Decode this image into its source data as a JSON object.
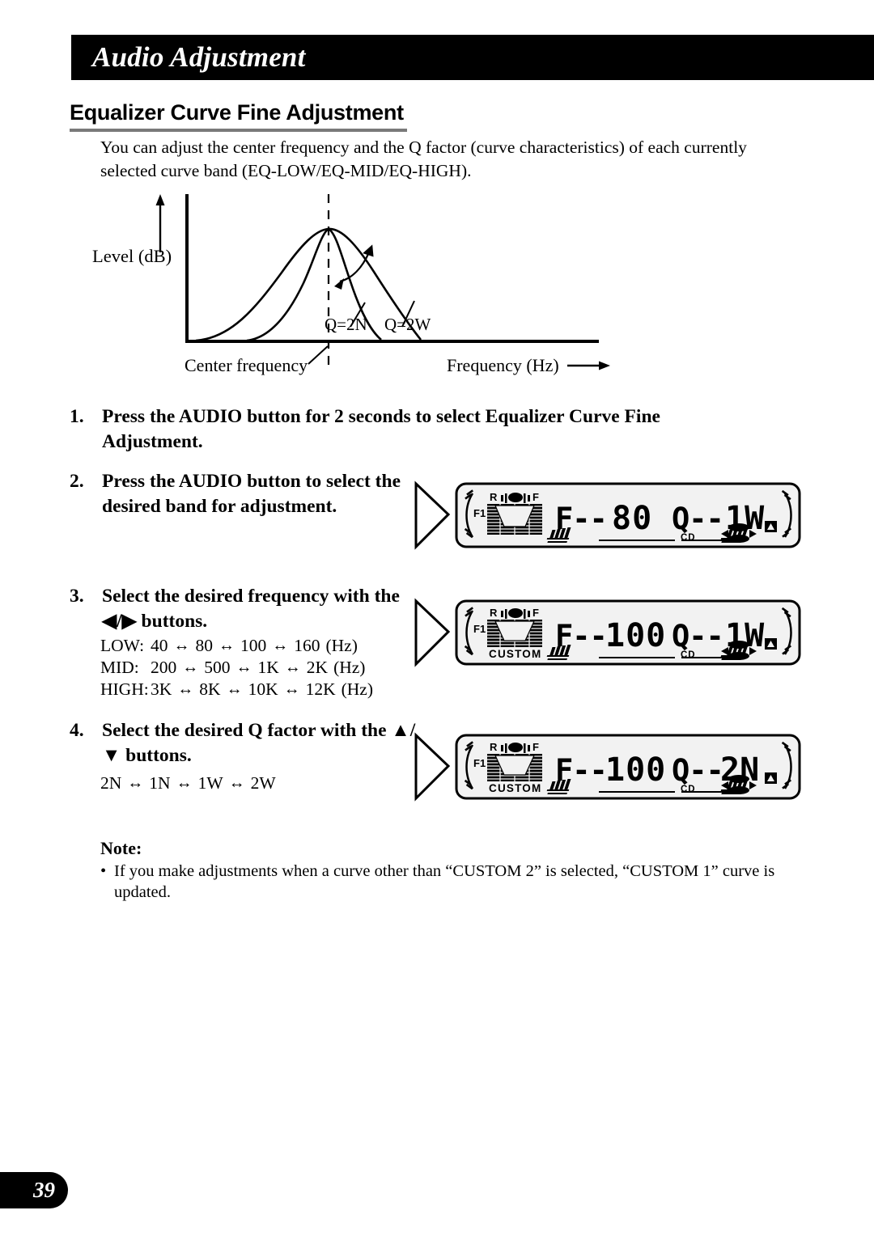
{
  "header": {
    "title": "Audio Adjustment"
  },
  "section": {
    "heading": "Equalizer Curve Fine Adjustment",
    "intro": "You can adjust the center frequency and the Q factor (curve characteristics) of each currently selected curve band (EQ-LOW/EQ-MID/EQ-HIGH)."
  },
  "chart_data": {
    "type": "line",
    "title": "",
    "xlabel": "Frequency (Hz)",
    "ylabel": "Level (dB)",
    "grid": false,
    "annotations": [
      "Q=2N",
      "Q=2W",
      "Center frequency"
    ],
    "series": [
      {
        "name": "Q=2W",
        "note": "wide bell curve peaking at center frequency",
        "x": [
          0,
          10,
          22,
          35,
          48,
          60,
          72,
          85,
          100
        ],
        "y": [
          0,
          4,
          20,
          52,
          84,
          100,
          84,
          46,
          0
        ]
      },
      {
        "name": "Q=2N",
        "note": "narrow bell curve peaking at center frequency",
        "x": [
          28,
          38,
          48,
          56,
          60,
          66,
          72,
          78,
          86
        ],
        "y": [
          0,
          12,
          44,
          82,
          100,
          80,
          46,
          18,
          0
        ]
      }
    ],
    "axis_labels": {
      "y_axis": "Level (dB)",
      "x_axis": "Frequency (Hz)",
      "center_marker": "Center frequency"
    },
    "curve_labels": {
      "narrow": "Q=2N",
      "wide": "Q=2W"
    }
  },
  "steps": [
    {
      "number": "1.",
      "text": "Press the AUDIO button for 2 seconds to select Equalizer Curve Fine Adjustment."
    },
    {
      "number": "2.",
      "text": "Press the AUDIO button to select the desired band for adjustment."
    },
    {
      "number": "3.",
      "text": "Select the desired frequency with the ◀/▶ buttons."
    },
    {
      "number": "4.",
      "text": "Select the desired Q factor with the ▲/▼ buttons."
    }
  ],
  "frequency_table": {
    "arrow": "↔",
    "rows": [
      {
        "label": "LOW:",
        "values": [
          "40",
          "80",
          "100",
          "160"
        ],
        "unit": "(Hz)"
      },
      {
        "label": "MID:",
        "values": [
          "200",
          "500",
          "1K",
          "2K"
        ],
        "unit": "(Hz)"
      },
      {
        "label": "HIGH:",
        "values": [
          "3K",
          "8K",
          "10K",
          "12K"
        ],
        "unit": "(Hz)"
      }
    ]
  },
  "q_factor_list": {
    "arrow": "↔",
    "values": [
      "2N",
      "1N",
      "1W",
      "2W"
    ]
  },
  "note": {
    "title": "Note:",
    "bullet": "•",
    "text": "If you make adjustments when a curve other than “CUSTOM 2” is selected, “CUSTOM 1” curve is updated."
  },
  "displays": [
    {
      "id": "display-step2",
      "preset_label": "F1",
      "custom_label": "",
      "speaker_left": "R",
      "speaker_right": "F",
      "freq_field": "F--",
      "freq_value": "80",
      "q_field": "Q--",
      "q_value": "1W",
      "media_label": "CD"
    },
    {
      "id": "display-step3",
      "preset_label": "F1",
      "custom_label": "CUSTOM",
      "speaker_left": "R",
      "speaker_right": "F",
      "freq_field": "F--",
      "freq_value": "100",
      "q_field": "Q--",
      "q_value": "1W",
      "media_label": "CD"
    },
    {
      "id": "display-step4",
      "preset_label": "F1",
      "custom_label": "CUSTOM",
      "speaker_left": "R",
      "speaker_right": "F",
      "freq_field": "F--",
      "freq_value": "100",
      "q_field": "Q--",
      "q_value": "2N",
      "media_label": "CD"
    }
  ],
  "page": {
    "number": "39"
  },
  "colors": {
    "header_bg": "#000000",
    "header_text": "#ffffff",
    "heading_rule": "#7a7a7a",
    "lcd_bg": "#f2f2f2",
    "lcd_fg": "#000000"
  }
}
